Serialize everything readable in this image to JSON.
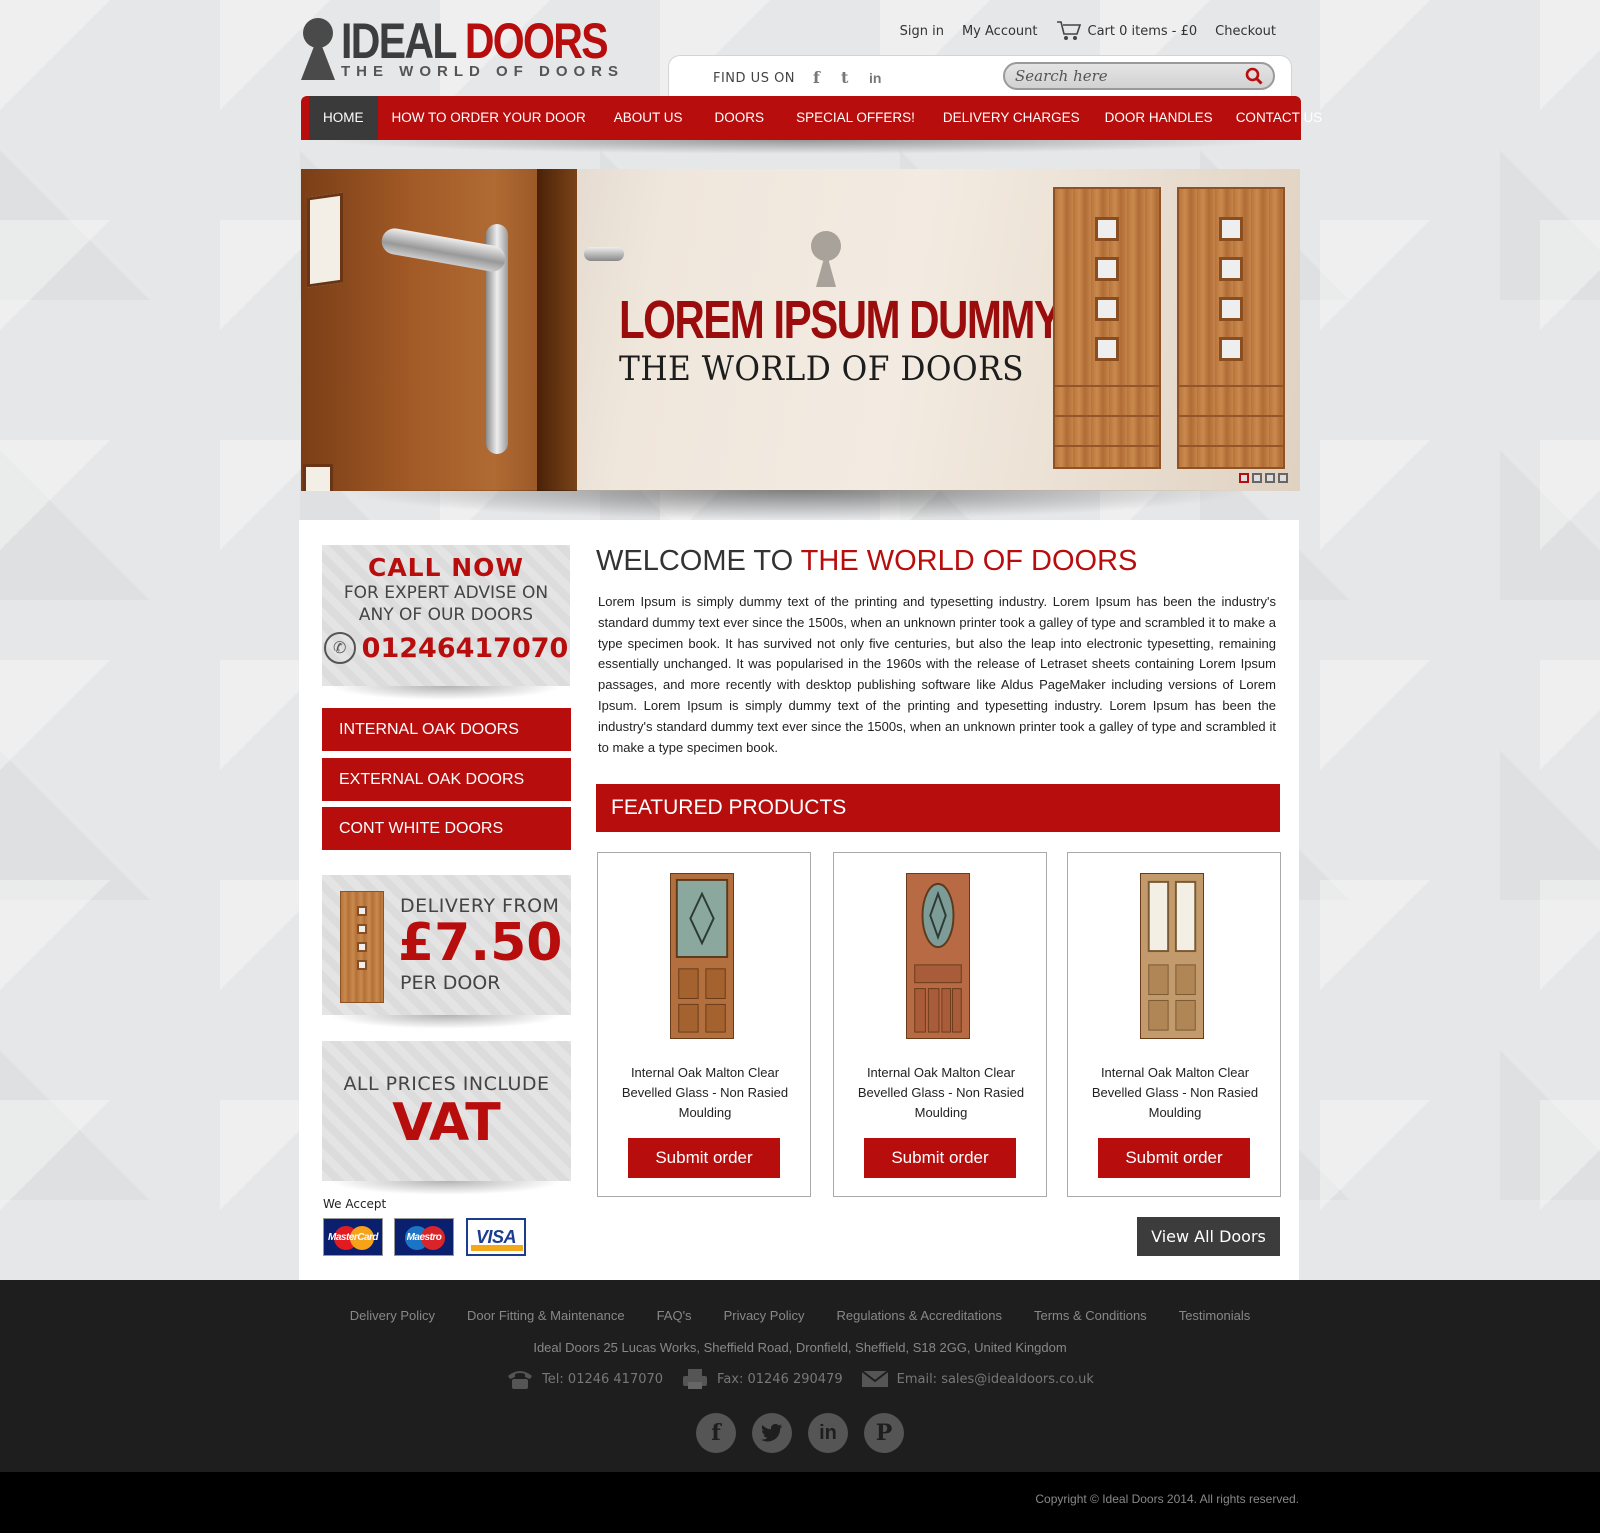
{
  "brand": {
    "name_part1": "IDEAL",
    "name_part2": "DOORS",
    "tagline": "THE WORLD OF DOORS"
  },
  "top_links": {
    "sign_in": "Sign in",
    "account": "My Account",
    "cart": "Cart 0 items - £0",
    "checkout": "Checkout"
  },
  "find_us": {
    "label": "FIND US ON",
    "networks": [
      "f",
      "t",
      "in"
    ]
  },
  "search": {
    "placeholder": "Search here"
  },
  "nav": [
    "HOME",
    "HOW TO ORDER YOUR DOOR",
    "ABOUT US",
    "DOORS",
    "SPECIAL OFFERS!",
    "DELIVERY CHARGES",
    "DOOR HANDLES",
    "CONTACT US"
  ],
  "hero": {
    "title": "LOREM IPSUM DUMMY",
    "subtitle": "THE WORLD OF DOORS",
    "slides": 4,
    "active_slide": 1
  },
  "call_box": {
    "title": "CALL NOW",
    "line1": "FOR EXPERT ADVISE ON",
    "line2": "ANY OF OUR DOORS",
    "phone": "01246417070"
  },
  "categories": [
    "INTERNAL OAK DOORS",
    "EXTERNAL OAK DOORS",
    "CONT WHITE DOORS"
  ],
  "delivery": {
    "line1": "DELIVERY FROM",
    "price": "£7.50",
    "line2": "PER DOOR"
  },
  "vat": {
    "line1": "ALL PRICES INCLUDE",
    "line2": "VAT"
  },
  "payments": {
    "label": "We Accept",
    "cards": [
      "MasterCard",
      "Maestro",
      "VISA"
    ]
  },
  "welcome": {
    "title_plain": "WELCOME TO ",
    "title_red": "THE WORLD OF DOORS",
    "body": "Lorem Ipsum is simply dummy text of the printing and typesetting industry. Lorem Ipsum has been the industry's standard dummy text ever since the 1500s, when an unknown printer took a galley of type and scrambled it to make a type specimen book. It has survived not only five centuries, but also the leap into electronic typesetting, remaining essentially unchanged. It was popularised in the 1960s with the release of Letraset sheets containing Lorem Ipsum passages, and more recently with desktop publishing software like Aldus PageMaker including versions of Lorem Ipsum. Lorem Ipsum is simply dummy text of the printing and typesetting industry. Lorem Ipsum has been the industry's standard dummy text ever since the 1500s, when an unknown printer took a galley of type and scrambled it to make a type specimen book."
  },
  "featured": {
    "title": "FEATURED PRODUCTS",
    "products": [
      {
        "name": "Internal Oak Malton Clear Bevelled Glass - Non Rasied Moulding",
        "button": "Submit order"
      },
      {
        "name": "Internal Oak Malton Clear Bevelled Glass - Non Rasied Moulding",
        "button": "Submit order"
      },
      {
        "name": "Internal Oak Malton Clear Bevelled Glass - Non Rasied Moulding",
        "button": "Submit order"
      }
    ],
    "view_all": "View All Doors"
  },
  "footer": {
    "links": [
      "Delivery Policy",
      "Door Fitting & Maintenance",
      "FAQ's",
      "Privacy Policy",
      "Regulations & Accreditations",
      "Terms & Conditions",
      "Testimonials"
    ],
    "address": "Ideal Doors 25 Lucas Works, Sheffield Road, Dronfield, Sheffield, S18 2GG, United Kingdom",
    "tel": "Tel: 01246 417070",
    "fax": "Fax: 01246 290479",
    "email": "Email: sales@idealdoors.co.uk",
    "social": [
      "facebook",
      "twitter",
      "linkedin",
      "pinterest"
    ],
    "copyright": "Copyright © Ideal Doors 2014. All rights reserved."
  },
  "colors": {
    "accent": "#b80d0d",
    "dark": "#3a3a3a",
    "footer": "#1e1e1e"
  }
}
